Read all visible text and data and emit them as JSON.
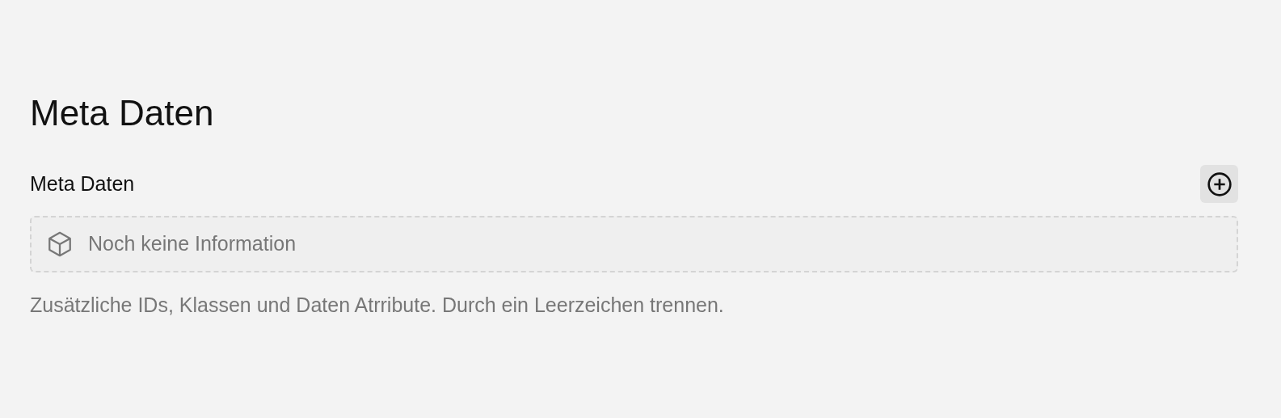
{
  "heading": "Meta Daten",
  "field": {
    "label": "Meta Daten",
    "empty_text": "Noch keine Information",
    "help": "Zusätzliche IDs, Klassen und Daten Atrribute. Durch ein Leerzeichen trennen."
  }
}
